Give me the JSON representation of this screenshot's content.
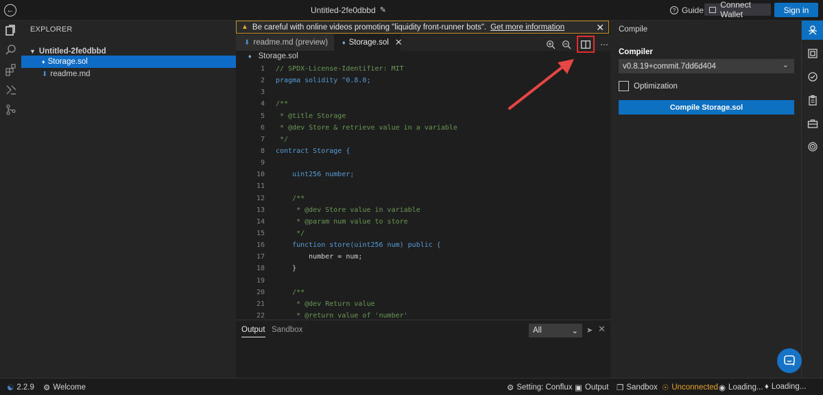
{
  "topbar": {
    "title": "Untitled-2fe0dbbd",
    "guide_label": "Guide",
    "connect_label": "Connect Wallet",
    "signin_label": "Sign in"
  },
  "explorer": {
    "title": "EXPLORER",
    "project": "Untitled-2fe0dbbd",
    "files": [
      {
        "name": "Storage.sol",
        "active": true
      },
      {
        "name": "readme.md",
        "active": false
      }
    ]
  },
  "warning": {
    "text": "Be careful with online videos promoting \"liquidity front-runner bots\".",
    "link": "Get more information"
  },
  "editor": {
    "tabs": [
      {
        "label": "readme.md (preview)"
      },
      {
        "label": "Storage.sol"
      }
    ],
    "breadcrumb": "Storage.sol",
    "code_lines": [
      "// SPDX-License-Identifier: MIT",
      "pragma solidity ^0.8.0;",
      "",
      "/**",
      " * @title Storage",
      " * @dev Store & retrieve value in a variable",
      " */",
      "contract Storage {",
      "",
      "    uint256 number;",
      "",
      "    /**",
      "     * @dev Store value in variable",
      "     * @param num value to store",
      "     */",
      "    function store(uint256 num) public {",
      "        number = num;",
      "    }",
      "",
      "    /**",
      "     * @dev Return value",
      "     * @return value of 'number'"
    ]
  },
  "output_panel": {
    "tab_output": "Output",
    "tab_sandbox": "Sandbox",
    "filter_value": "All"
  },
  "compile": {
    "title": "Compile",
    "compiler_label": "Compiler",
    "version": "v0.8.19+commit.7dd6d404",
    "optimization_label": "Optimization",
    "button_label": "Compile Storage.sol"
  },
  "status": {
    "version": "2.2.9",
    "welcome": "Welcome",
    "setting": "Setting: Conflux",
    "output": "Output",
    "sandbox": "Sandbox",
    "connection": "Unconnected",
    "loading1": "Loading...",
    "loading2": "Loading..."
  },
  "colors": {
    "accent": "#0e70c0",
    "warning": "#e7a52c",
    "highlight": "#e42d2d"
  }
}
